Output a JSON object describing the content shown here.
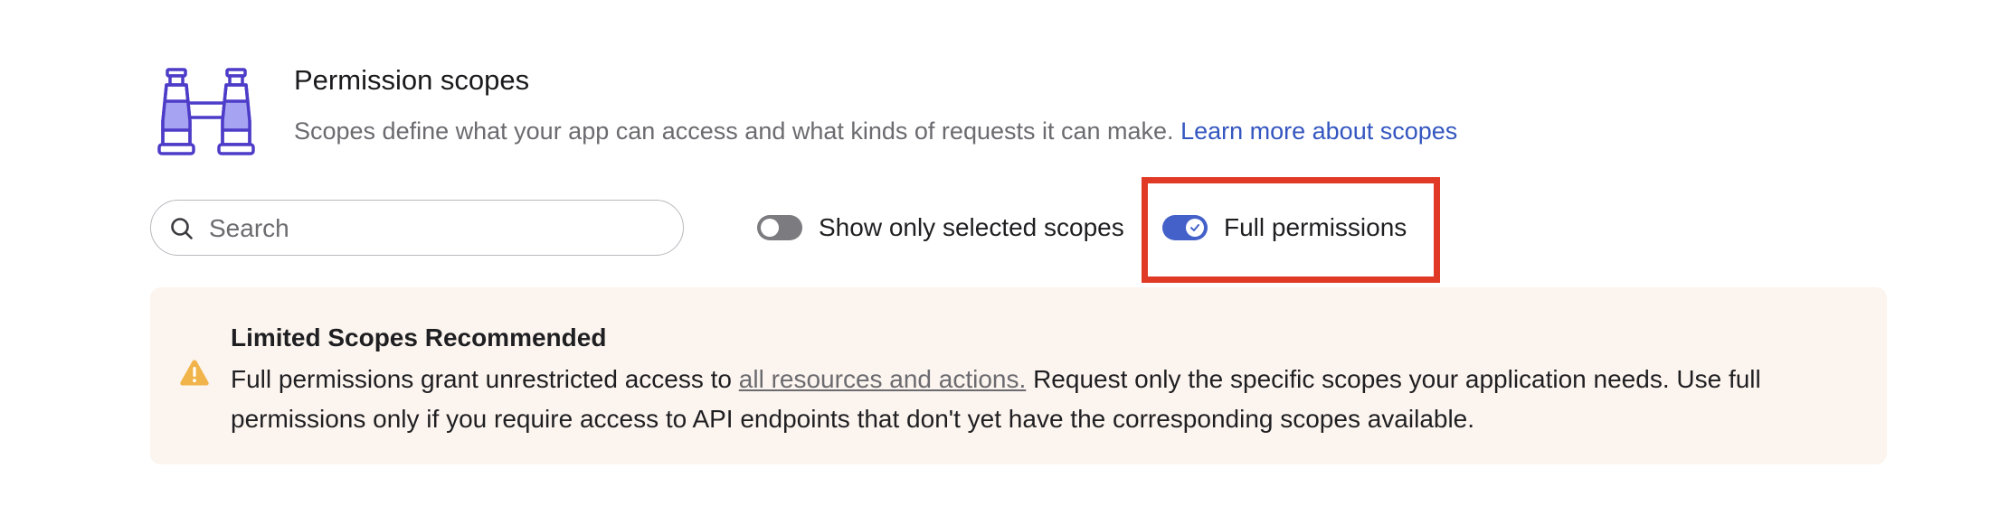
{
  "header": {
    "title": "Permission scopes",
    "subtitle": "Scopes define what your app can access and what kinds of requests it can make.",
    "learn_more_label": "Learn more about scopes",
    "illustration_icon": "binoculars-icon"
  },
  "search": {
    "placeholder": "Search",
    "value": "",
    "icon": "search-icon"
  },
  "toggles": {
    "show_selected": {
      "label": "Show only selected scopes",
      "checked": false
    },
    "full_permissions": {
      "label": "Full permissions",
      "checked": true,
      "highlighted": true
    }
  },
  "banner": {
    "icon": "warning-icon",
    "title": "Limited Scopes Recommended",
    "body_before_link": "Full permissions grant unrestricted access to",
    "link_label": "all resources and actions.",
    "body_after_link": "Request only the specific scopes your application needs. Use full permissions only if you require access to API endpoints that don't yet have the corresponding scopes available."
  },
  "colors": {
    "accent": "#4461c9",
    "link": "#3456c0",
    "highlight": "#e03a26",
    "banner_bg": "#fcf4ee",
    "warning": "#f0b44a",
    "illustration_stroke": "#4d3cc8",
    "illustration_fill": "#a7a3f3"
  }
}
